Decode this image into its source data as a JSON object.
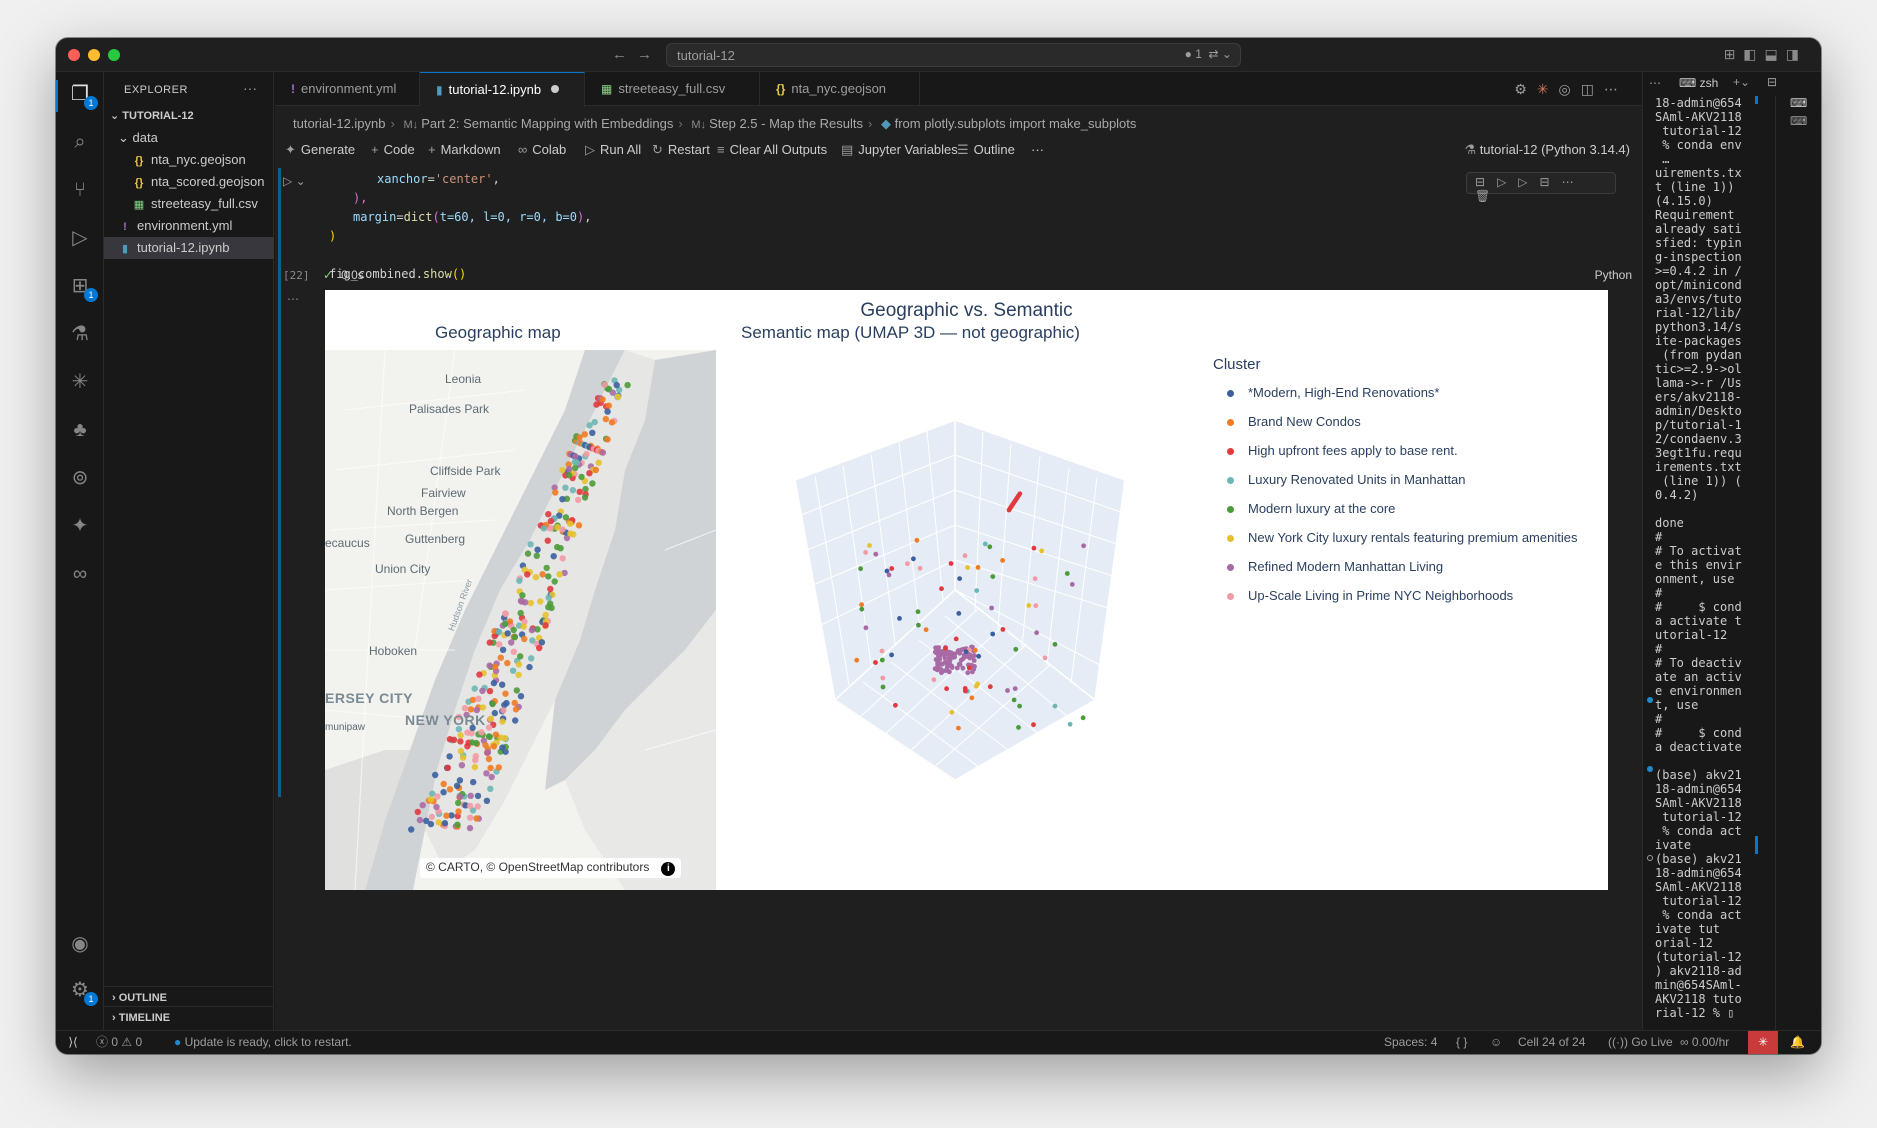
{
  "window": {
    "command_center": "tutorial-12",
    "command_center_badge": "1"
  },
  "explorer": {
    "title": "EXPLORER",
    "more": "···",
    "root": "TUTORIAL-12",
    "folder": "data",
    "items": [
      {
        "name": "nta_nyc.geojson",
        "icon": "{}",
        "color": "#e8c84a"
      },
      {
        "name": "nta_scored.geojson",
        "icon": "{}",
        "color": "#e8c84a"
      },
      {
        "name": "streeteasy_full.csv",
        "icon": "▦",
        "color": "#89d185"
      }
    ],
    "root_items": [
      {
        "name": "environment.yml",
        "icon": "!",
        "color": "#a074c4"
      },
      {
        "name": "tutorial-12.ipynb",
        "icon": "▮",
        "color": "#519aba"
      }
    ],
    "outline": "OUTLINE",
    "timeline": "TIMELINE"
  },
  "activity_badges": {
    "explorer": "1",
    "extensions": "1",
    "settings": "1"
  },
  "tabs": [
    {
      "label": "environment.yml",
      "icon": "!",
      "color": "#a074c4"
    },
    {
      "label": "tutorial-12.ipynb",
      "icon": "▮",
      "color": "#519aba"
    },
    {
      "label": "streeteasy_full.csv",
      "icon": "▦",
      "color": "#89d185"
    },
    {
      "label": "nta_nyc.geojson",
      "icon": "{}",
      "color": "#e8c84a"
    }
  ],
  "breadcrumb": {
    "file": "tutorial-12.ipynb",
    "part": "Part 2: Semantic Mapping with Embeddings",
    "step": "Step 2.5 - Map the Results",
    "cell": "from plotly.subplots import make_subplots"
  },
  "toolbar": {
    "generate": "Generate",
    "code": "Code",
    "markdown": "Markdown",
    "colab": "Colab",
    "run_all": "Run All",
    "restart": "Restart",
    "clear_outputs": "Clear All Outputs",
    "jupyter_vars": "Jupyter Variables",
    "outline": "Outline",
    "more": "···",
    "kernel": "tutorial-12 (Python 3.14.4)"
  },
  "cell": {
    "exec_count": "[22]",
    "duration": "0.0s",
    "language": "Python",
    "code_xanchor_key": "xanchor",
    "code_xanchor_val": "'center'",
    "code_close": "),",
    "code_margin": "margin",
    "code_dict": "dict",
    "code_margin_args": "t=60, l=0, r=0, b=0",
    "code_close2": ")",
    "code_show": "fig_combined.",
    "code_show_fn": "show",
    "code_show_end": "()"
  },
  "plot": {
    "title": "Geographic vs. Semantic",
    "left_title": "Geographic map",
    "right_title": "Semantic map (UMAP 3D — not geographic)",
    "attribution_pre": "© CARTO, © ",
    "attribution_osm": "OpenStreetMap",
    "attribution_post": " contributors",
    "attribution_info": "i",
    "map_labels": [
      "Leonia",
      "Palisades Park",
      "Cliffside Park",
      "Fairview",
      "North Bergen",
      "Guttenberg",
      "Union City",
      "Hoboken",
      "ERSEY CITY",
      "NEW YORK",
      "ecaucus",
      "munipaw",
      "Hudson River"
    ]
  },
  "chart_data": {
    "type": "scatter",
    "title": "Geographic vs. Semantic",
    "legend_title": "Cluster",
    "legend_position": "right",
    "series": [
      {
        "name": "*Modern, High-End Renovations*",
        "color": "#3b5f9e"
      },
      {
        "name": "Brand New Condos",
        "color": "#ef7b23"
      },
      {
        "name": "High upfront fees apply to base rent.",
        "color": "#e0393e"
      },
      {
        "name": "Luxury Renovated Units in Manhattan",
        "color": "#6cb6b4"
      },
      {
        "name": "Modern luxury at the core",
        "color": "#4c9b3a"
      },
      {
        "name": "New York City luxury rentals featuring premium amenities",
        "color": "#e6c12e"
      },
      {
        "name": "Refined Modern Manhattan Living",
        "color": "#a86aa4"
      },
      {
        "name": "Up-Scale Living in Prime NYC Neighborhoods",
        "color": "#f29aa4"
      }
    ]
  },
  "terminal": {
    "shell": "zsh",
    "lines": [
      "18-admin@654",
      "SAml-AKV2118",
      " tutorial-12",
      " % conda env",
      " …",
      "uirements.tx",
      "t (line 1))",
      "(4.15.0)",
      "Requirement ",
      "already sati",
      "sfied: typin",
      "g-inspection",
      ">=0.4.2 in /",
      "opt/minicond",
      "a3/envs/tuto",
      "rial-12/lib/",
      "python3.14/s",
      "ite-packages",
      " (from pydan",
      "tic>=2.9->ol",
      "lama->-r /Us",
      "ers/akv2118-",
      "admin/Deskto",
      "p/tutorial-1",
      "2/condaenv.3",
      "3egt1fu.requ",
      "irements.txt",
      " (line 1)) (",
      "0.4.2)",
      "",
      "done",
      "#",
      "# To activat",
      "e this envir",
      "onment, use",
      "#",
      "#     $ cond",
      "a activate t",
      "utorial-12",
      "#",
      "# To deactiv",
      "ate an activ",
      "e environmen",
      "t, use",
      "#",
      "#     $ cond",
      "a deactivate",
      "",
      "(base) akv21",
      "18-admin@654",
      "SAml-AKV2118",
      " tutorial-12",
      " % conda act",
      "ivate",
      "(base) akv21",
      "18-admin@654",
      "SAml-AKV2118",
      " tutorial-12",
      " % conda act",
      "ivate tut",
      "orial-12",
      "(tutorial-12",
      ") akv2118-ad",
      "min@654SAml-",
      "AKV2118 tuto",
      "rial-12 % ▯"
    ]
  },
  "status": {
    "errors": "0",
    "warnings": "0",
    "update": "Update is ready, click to restart.",
    "spaces": "Spaces: 4",
    "braces": "{ }",
    "cell": "Cell 24 of 24",
    "go_live": "Go Live",
    "cost": "0.00/hr"
  }
}
